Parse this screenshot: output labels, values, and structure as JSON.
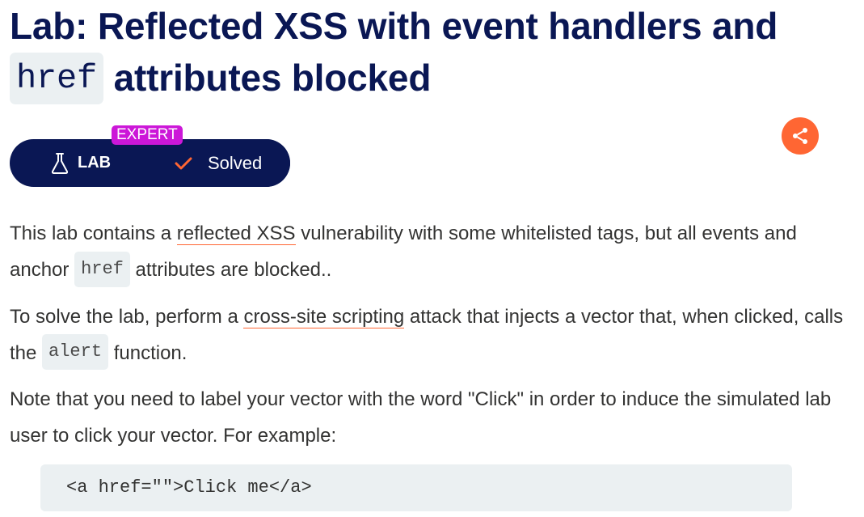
{
  "title": {
    "prefix": "Lab: Reflected XSS with event handlers and",
    "code": "href",
    "suffix": "attributes blocked"
  },
  "badges": {
    "level": "EXPERT",
    "lab_label": "LAB",
    "status_label": "Solved"
  },
  "icons": {
    "lab": "flask-icon",
    "status": "check-icon",
    "share": "share-icon"
  },
  "colors": {
    "navy": "#0a1754",
    "accent": "#ff6633",
    "expert": "#cc17d8",
    "code_bg": "#ebf0f2"
  },
  "paragraphs": {
    "p1": {
      "before": "This lab contains a ",
      "link": "reflected XSS",
      "middle": " vulnerability with some whitelisted tags, but all events and anchor ",
      "code": "href",
      "after": " attributes are blocked.."
    },
    "p2": {
      "before": "To solve the lab, perform a ",
      "link": "cross-site scripting",
      "middle": " attack that injects a vector that, when clicked, calls the ",
      "code": "alert",
      "after": " function."
    },
    "p3": {
      "text": "Note that you need to label your vector with the word \"Click\" in order to induce the simulated lab user to click your vector. For example:"
    }
  },
  "code_example": "<a href=\"\">Click me</a>"
}
